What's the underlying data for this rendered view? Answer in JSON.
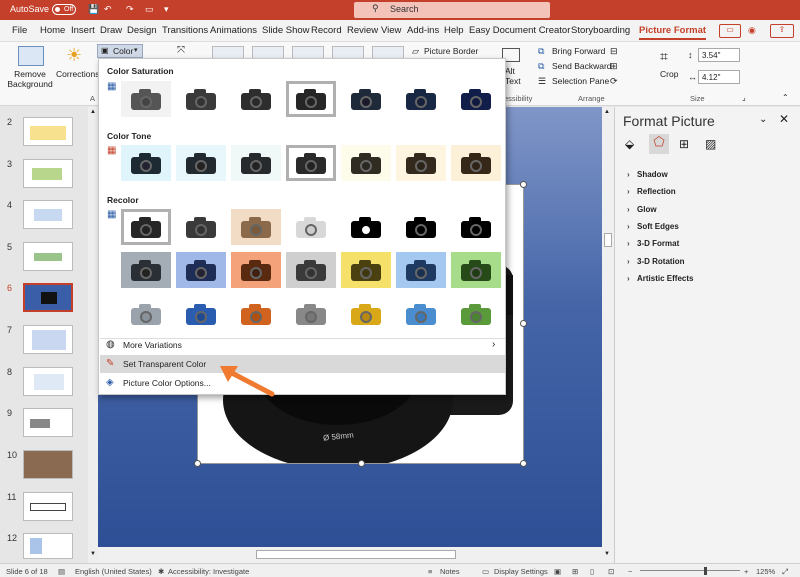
{
  "titlebar": {
    "autosave": "AutoSave",
    "toggle": "Off",
    "search_placeholder": "Search"
  },
  "tabs": [
    "File",
    "Home",
    "Insert",
    "Draw",
    "Design",
    "Transitions",
    "Animations",
    "Slide Show",
    "Record",
    "Review",
    "View",
    "Add-ins",
    "Help",
    "Easy Document Creator",
    "Storyboarding",
    "Picture Format"
  ],
  "ribbon": {
    "remove_background": "Remove Background",
    "corrections": "Corrections",
    "color": "Color",
    "picture_border": "Picture Border",
    "alt_text": "Alt Text",
    "bring_forward": "Bring Forward",
    "send_backward": "Send Backward",
    "selection_pane": "Selection Pane",
    "arrange": "Arrange",
    "crop": "Crop",
    "height": "3.54\"",
    "width": "4.12\"",
    "size": "Size",
    "accessibility_partial": "essibility"
  },
  "dropdown": {
    "color_saturation": "Color Saturation",
    "color_tone": "Color Tone",
    "recolor": "Recolor",
    "more_variations": "More Variations",
    "set_transparent": "Set Transparent Color",
    "picture_color_options": "Picture Color Options..."
  },
  "slides": [
    "2",
    "3",
    "4",
    "5",
    "6",
    "7",
    "8",
    "9",
    "10",
    "11",
    "12"
  ],
  "lens_text": "Ø 58mm",
  "panel": {
    "title": "Format Picture",
    "rows": [
      "Shadow",
      "Reflection",
      "Glow",
      "Soft Edges",
      "3-D Format",
      "3-D Rotation",
      "Artistic Effects"
    ]
  },
  "status": {
    "slide": "Slide 6 of 18",
    "language": "English (United States)",
    "accessibility": "Accessibility: Investigate",
    "notes": "Notes",
    "display": "Display Settings",
    "zoom": "125%"
  },
  "colors": {
    "accent": "#c4402a",
    "slide_top": "#8096c8",
    "slide_bottom": "#2e4f95",
    "arrow": "#f07a30"
  }
}
